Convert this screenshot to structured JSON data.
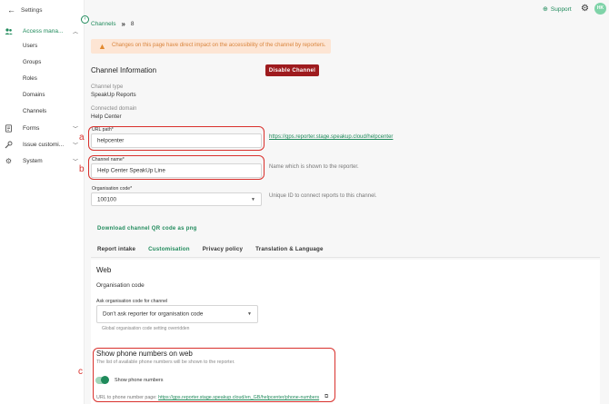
{
  "sidebar": {
    "back_label": "Settings",
    "groups": [
      {
        "label": "Access mana...",
        "icon": "users-icon"
      },
      {
        "label": "Forms",
        "icon": "document-icon"
      },
      {
        "label": "Issue customi...",
        "icon": "wrench-icon"
      },
      {
        "label": "System",
        "icon": "gear-icon"
      }
    ],
    "sub_items": [
      "Users",
      "Groups",
      "Roles",
      "Domains",
      "Channels"
    ]
  },
  "topbar": {
    "support_label": "Support",
    "avatar_initials": "HK"
  },
  "breadcrumb": {
    "parent": "Channels",
    "current": "8"
  },
  "warning": {
    "text": "Changes on this page have direct impact on the accessibility of the channel by reporters."
  },
  "channel_info": {
    "title": "Channel Information",
    "disable_button": "Disable Channel",
    "channel_type_label": "Channel type",
    "channel_type_value": "SpeakUp Reports",
    "connected_domain_label": "Connected domain",
    "connected_domain_value": "Help Center"
  },
  "fields": {
    "url_path": {
      "label": "URL path*",
      "value": "helpcenter",
      "link": "https://gps.reporter.stage.speakup.cloud/helpcenter"
    },
    "channel_name": {
      "label": "Channel name*",
      "value": "Help Center SpeakUp Line",
      "hint": "Name which is shown to the reporter."
    },
    "organisation_code": {
      "label": "Organisation code*",
      "value": "100100",
      "hint": "Unique ID to connect reports to this channel."
    }
  },
  "qr_link": "Download channel QR code as png",
  "tabs": [
    "Report intake",
    "Customisation",
    "Privacy policy",
    "Translation & Language"
  ],
  "active_tab": "Customisation",
  "web": {
    "title": "Web",
    "org_code_title": "Organisation code",
    "ask_label": "Ask organisation code for channel",
    "ask_value": "Don't ask reporter for organisation code",
    "ask_hint": "Global organisation code setting overridden"
  },
  "phone": {
    "title": "Show phone numbers on web",
    "description": "The list of available phone numbers will be shown to the reporter.",
    "toggle_label": "Show phone numbers",
    "toggle_on": true,
    "url_prefix": "URL to phone number page:",
    "url": "https://gps.reporter.stage.speakup.cloud/en_GB/helpcenter/phone-numbers"
  },
  "annotations": {
    "a": "a",
    "b": "b",
    "c": "c"
  },
  "colors": {
    "accent": "#1f8a5b",
    "danger": "#9e1b1e",
    "annotation": "#d9302c",
    "warning_bg": "#fde5d4"
  }
}
